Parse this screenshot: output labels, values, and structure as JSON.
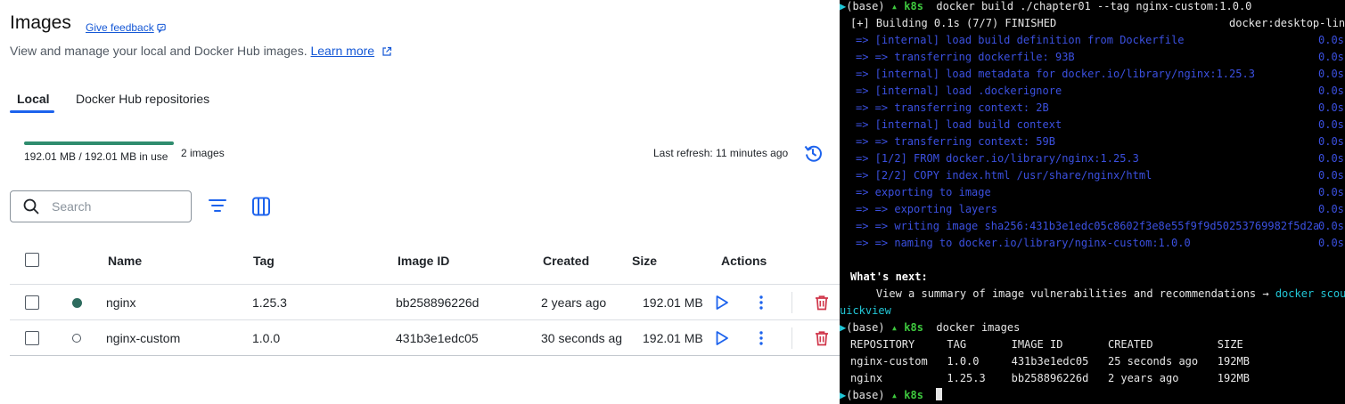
{
  "page": {
    "title": "Images",
    "feedback_label": "Give feedback",
    "subtitle": "View and manage your local and Docker Hub images.",
    "learn_more_label": "Learn more"
  },
  "tabs": [
    {
      "label": "Local",
      "active": true
    },
    {
      "label": "Docker Hub repositories",
      "active": false
    }
  ],
  "usage": {
    "text": "192.01 MB / 192.01 MB in use",
    "count": "2 images",
    "fill_fraction": 1.0,
    "last_refresh": "Last refresh: 11 minutes ago"
  },
  "search": {
    "placeholder": "Search",
    "value": ""
  },
  "table": {
    "columns": [
      "Name",
      "Tag",
      "Image ID",
      "Created",
      "Size",
      "Actions"
    ],
    "rows": [
      {
        "name": "nginx",
        "tag": "1.25.3",
        "image_id": "bb258896226d",
        "created": "2 years ago",
        "size": "192.01 MB",
        "in_use": true
      },
      {
        "name": "nginx-custom",
        "tag": "1.0.0",
        "image_id": "431b3e1edc05",
        "created": "30 seconds ag",
        "size": "192.01 MB",
        "in_use": false
      }
    ]
  },
  "terminal": {
    "prompt": {
      "env": "(base)",
      "arrow": "▶",
      "context": "k8s"
    },
    "lines": [
      {
        "kind": "prompt",
        "command": "docker build ./chapter01 --tag nginx-custom:1.0.0"
      },
      {
        "kind": "plain",
        "text": "[+] Building 0.1s (7/7) FINISHED",
        "right": "docker:desktop-linux"
      },
      {
        "kind": "step",
        "text": "=> [internal] load build definition from Dockerfile",
        "time": "0.0s"
      },
      {
        "kind": "step",
        "text": "=> => transferring dockerfile: 93B",
        "time": "0.0s"
      },
      {
        "kind": "step",
        "text": "=> [internal] load metadata for docker.io/library/nginx:1.25.3",
        "time": "0.0s"
      },
      {
        "kind": "step",
        "text": "=> [internal] load .dockerignore",
        "time": "0.0s"
      },
      {
        "kind": "step",
        "text": "=> => transferring context: 2B",
        "time": "0.0s"
      },
      {
        "kind": "step",
        "text": "=> [internal] load build context",
        "time": "0.0s"
      },
      {
        "kind": "step",
        "text": "=> => transferring context: 59B",
        "time": "0.0s"
      },
      {
        "kind": "step",
        "text": "=> [1/2] FROM docker.io/library/nginx:1.25.3",
        "time": "0.0s"
      },
      {
        "kind": "step",
        "text": "=> [2/2] COPY index.html /usr/share/nginx/html",
        "time": "0.0s"
      },
      {
        "kind": "step",
        "text": "=> exporting to image",
        "time": "0.0s"
      },
      {
        "kind": "step",
        "text": "=> => exporting layers",
        "time": "0.0s"
      },
      {
        "kind": "step",
        "text": "=> => writing image sha256:431b3e1edc05c8602f3e8e55f9f9d50253769982f5d2a",
        "time": "0.0s"
      },
      {
        "kind": "step",
        "text": "=> => naming to docker.io/library/nginx-custom:1.0.0",
        "time": "0.0s"
      },
      {
        "kind": "blank",
        "text": ""
      },
      {
        "kind": "bold",
        "text": "What's next:"
      },
      {
        "kind": "hint",
        "text": "    View a summary of image vulnerabilities and recommendations →",
        "link": "docker scout q"
      },
      {
        "kind": "cyan",
        "text": "uickview"
      },
      {
        "kind": "prompt",
        "command": "docker images"
      },
      {
        "kind": "plain",
        "text": "REPOSITORY     TAG       IMAGE ID       CREATED          SIZE"
      },
      {
        "kind": "plain",
        "text": "nginx-custom   1.0.0     431b3e1edc05   25 seconds ago   192MB"
      },
      {
        "kind": "plain",
        "text": "nginx          1.25.3    bb258896226d   2 years ago      192MB"
      },
      {
        "kind": "prompt_cursor",
        "command": ""
      }
    ]
  },
  "colors": {
    "accent": "#1d63ed",
    "in_use": "#2d6b5e",
    "delete": "#d0364a",
    "terminal_bg": "#000000",
    "terminal_blue": "#3b50e0",
    "terminal_green": "#3ec83e"
  }
}
